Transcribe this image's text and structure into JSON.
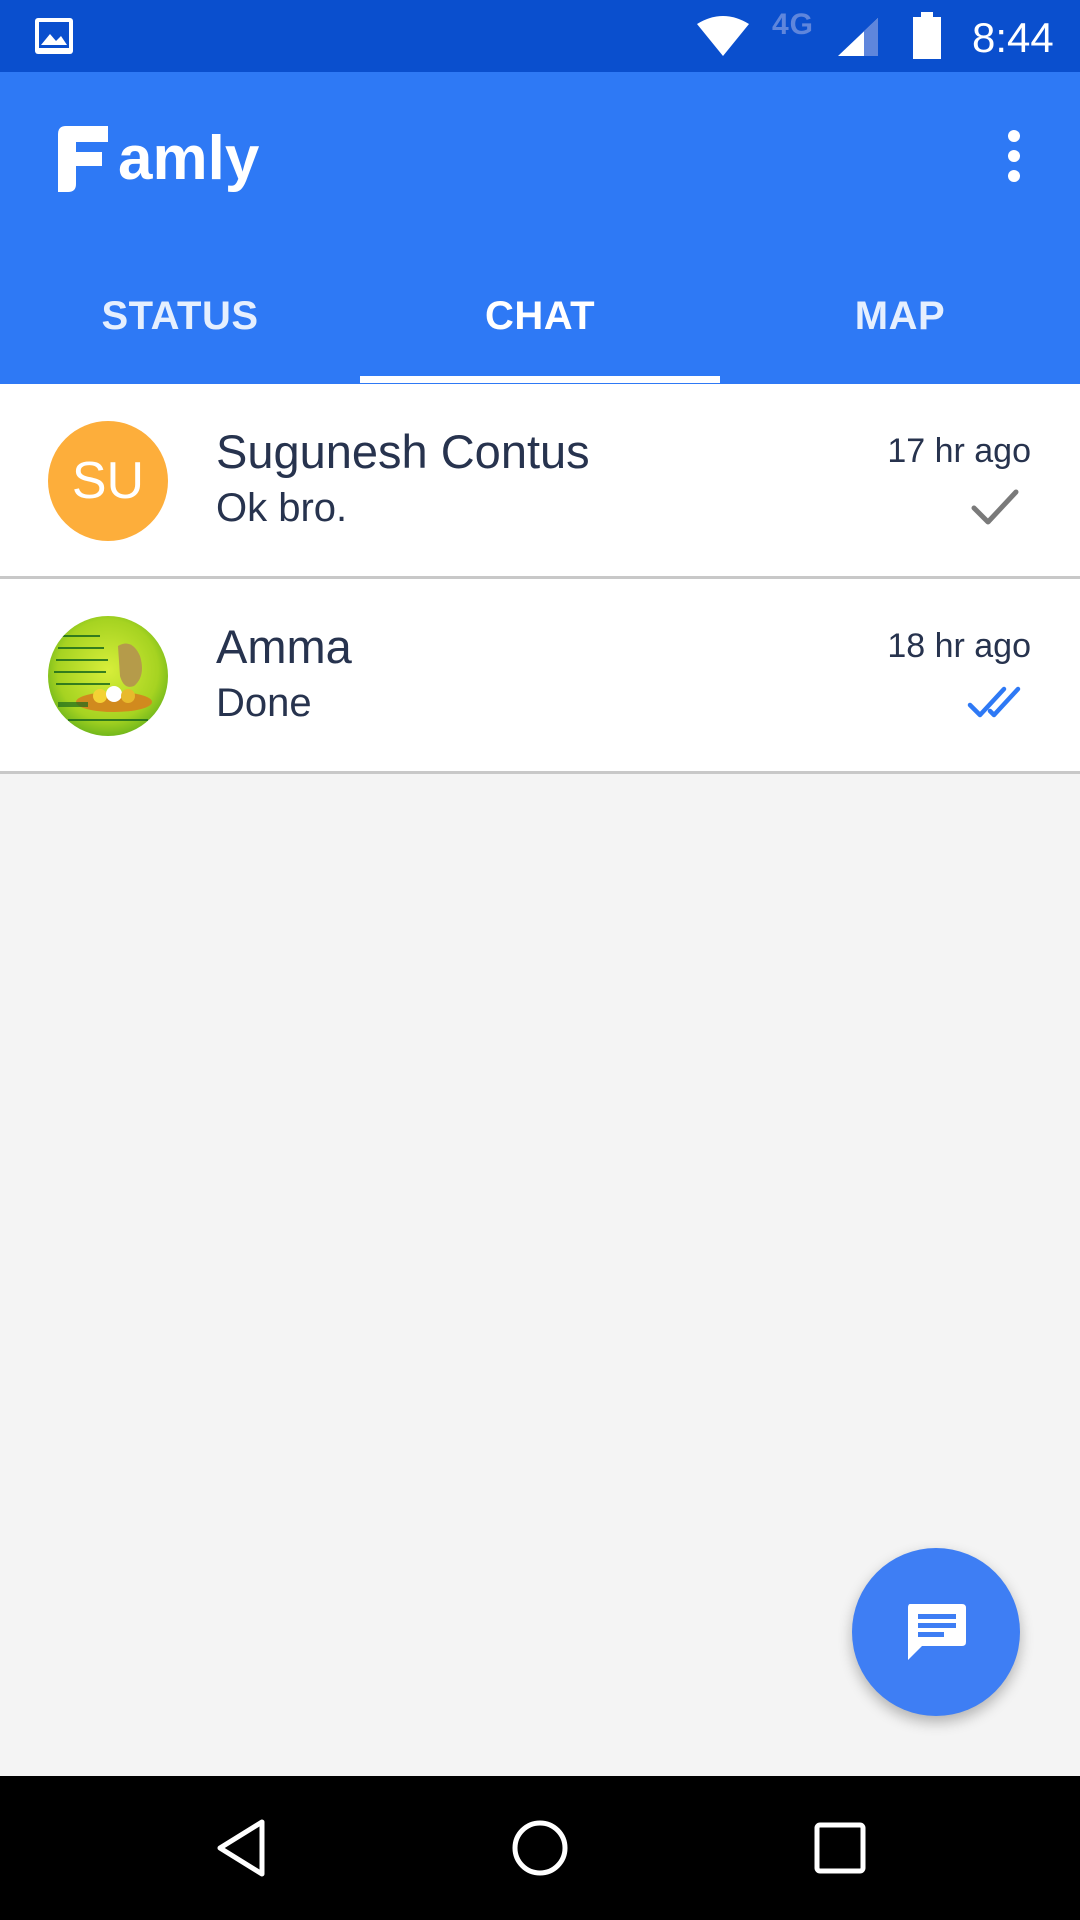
{
  "status_bar": {
    "time": "8:44",
    "network": "4G",
    "icons": [
      "gallery-icon",
      "wifi-icon",
      "signal-icon",
      "battery-icon"
    ]
  },
  "app_bar": {
    "title": "amly",
    "logo_letter": "F",
    "menu_icon": "more-vert-icon",
    "background": "#2e79f5"
  },
  "tabs": [
    {
      "label": "STATUS",
      "active": false
    },
    {
      "label": "CHAT",
      "active": true
    },
    {
      "label": "MAP",
      "active": false
    }
  ],
  "chats": [
    {
      "name": "Sugunesh Contus",
      "message": "Ok bro.",
      "time": "17 hr ago",
      "avatar_initials": "SU",
      "avatar_color": "#fdae3b",
      "status_icon": "check-icon",
      "status": "sent"
    },
    {
      "name": "Amma",
      "message": "Done",
      "time": "18 hr ago",
      "avatar_initials": "",
      "status_icon": "double-check-icon",
      "status": "read"
    }
  ],
  "fab": {
    "icon": "message-icon",
    "color": "#3e7ef4"
  },
  "nav_bar": {
    "icons": [
      "back-icon",
      "home-icon",
      "recents-icon"
    ]
  }
}
